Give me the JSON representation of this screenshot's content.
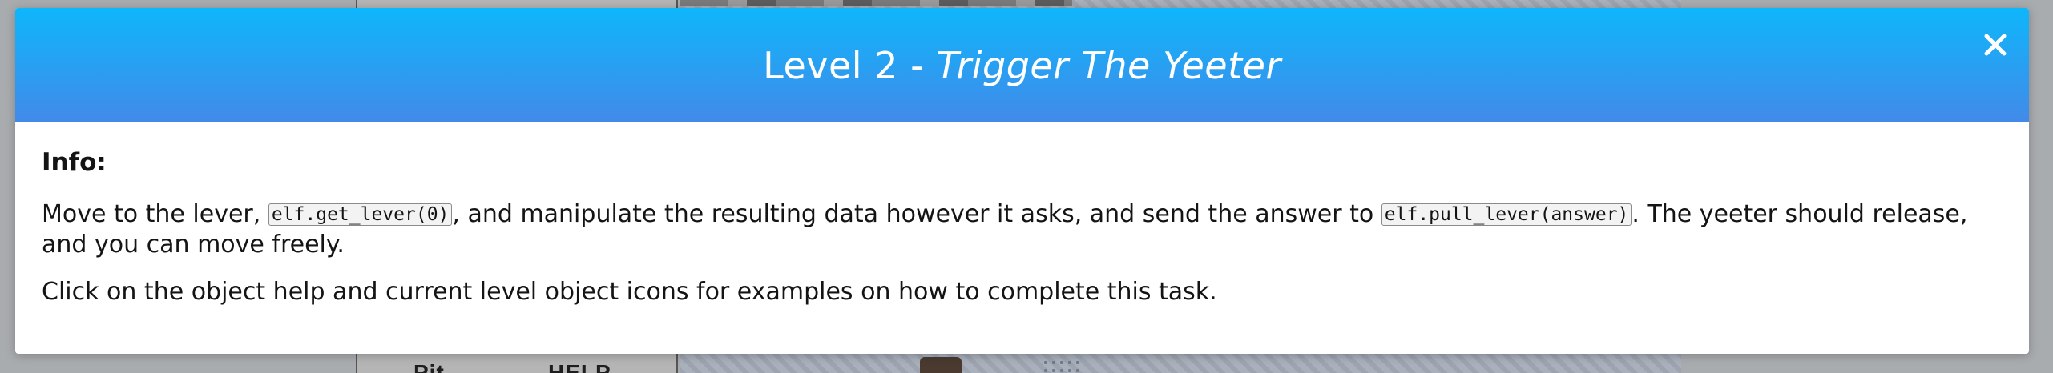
{
  "background": {
    "labels": {
      "pit": "Pit",
      "help": "HELP"
    }
  },
  "modal": {
    "title_prefix": "Level 2 - ",
    "title_name": "Trigger The Yeeter",
    "close_icon": "close-icon",
    "info_heading": "Info:",
    "instructions": {
      "part1": "Move to the lever, ",
      "code1": "elf.get_lever(0)",
      "part2": ", and manipulate the resulting data however it asks, and send the answer to ",
      "code2": "elf.pull_lever(answer)",
      "part3": ". The yeeter should release, and you can move freely."
    },
    "hint": "Click on the object help and current level object icons for examples on how to complete this task."
  },
  "colors": {
    "header_gradient_top": "#0eb6fb",
    "header_gradient_bottom": "#428ae9",
    "title_text": "#ffffff",
    "body_text": "#141414"
  }
}
